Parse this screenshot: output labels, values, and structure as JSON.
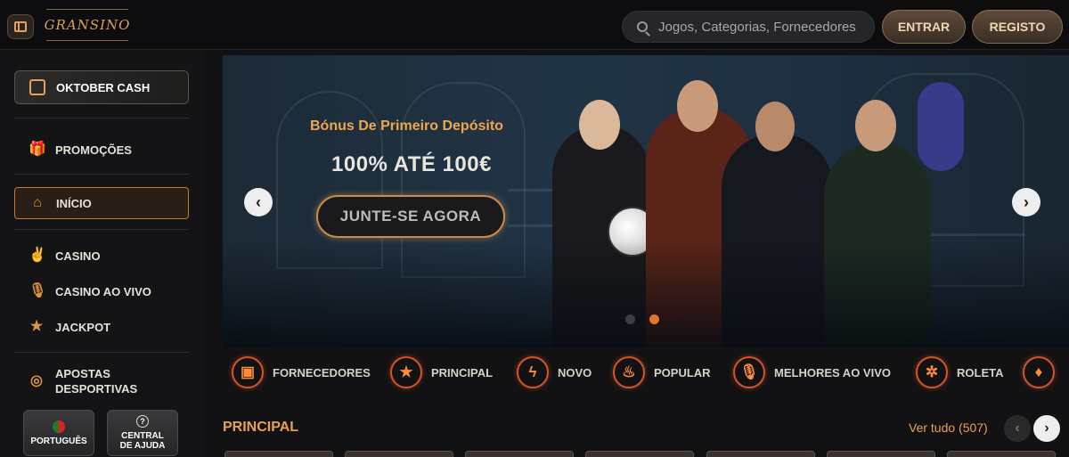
{
  "header": {
    "logo_text": "GRANSINO",
    "search_placeholder": "Jogos, Categorias, Fornecedores",
    "login_label": "ENTRAR",
    "register_label": "REGISTO"
  },
  "sidebar": {
    "featured": "OKTOBER CASH",
    "items": [
      {
        "label": "PROMOÇÕES",
        "icon": "gift-icon"
      },
      {
        "label": "INÍCIO",
        "icon": "home-icon",
        "active": true
      },
      {
        "label": "CASINO",
        "icon": "rock-hand-icon"
      },
      {
        "label": "CASINO AO VIVO",
        "icon": "microphone-icon"
      },
      {
        "label": "JACKPOT",
        "icon": "jackpot-win-icon"
      },
      {
        "label": "APOSTAS DESPORTIVAS",
        "icon": "basketball-icon"
      }
    ],
    "language_label": "PORTUGUÊS",
    "help_label": "CENTRAL DE AJUDA"
  },
  "banner": {
    "title": "Bónus De Primeiro Depósito",
    "subtitle": "100% ATÉ 100€",
    "cta": "JUNTE-SE AGORA",
    "slides": 2,
    "active_slide": 2
  },
  "categories": [
    {
      "label": "FORNECEDORES",
      "icon": "slot-machine-icon"
    },
    {
      "label": "PRINCIPAL",
      "icon": "star-icon"
    },
    {
      "label": "NOVO",
      "icon": "lightning-icon"
    },
    {
      "label": "POPULAR",
      "icon": "fire-icon"
    },
    {
      "label": "MELHORES AO VIVO",
      "icon": "microphone-icon"
    },
    {
      "label": "ROLETA",
      "icon": "roulette-icon"
    }
  ],
  "section": {
    "title": "PRINCIPAL",
    "see_all": "Ver tudo (507)"
  },
  "colors": {
    "accent": "#e9a14f",
    "background": "#121214",
    "active_border": "#c7782e"
  }
}
